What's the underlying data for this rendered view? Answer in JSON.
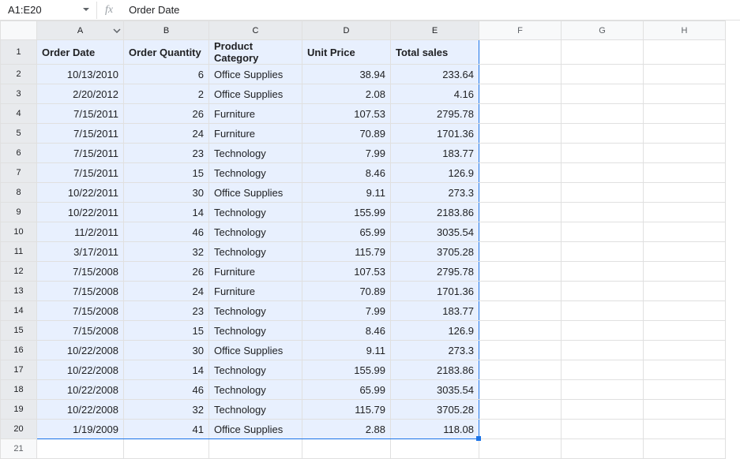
{
  "name_box": "A1:E20",
  "formula_bar": "Order Date",
  "col_headers": [
    "A",
    "B",
    "C",
    "D",
    "E",
    "F",
    "G",
    "H"
  ],
  "row_headers": [
    "1",
    "2",
    "3",
    "4",
    "5",
    "6",
    "7",
    "8",
    "9",
    "10",
    "11",
    "12",
    "13",
    "14",
    "15",
    "16",
    "17",
    "18",
    "19",
    "20",
    "21"
  ],
  "selected_cols": 5,
  "selected_rows": 20,
  "headers": [
    "Order Date",
    "Order Quantity",
    "Product Category",
    "Unit Price",
    "Total sales"
  ],
  "rows": [
    {
      "a": "10/13/2010",
      "b": "6",
      "c": "Office Supplies",
      "d": "38.94",
      "e": "233.64"
    },
    {
      "a": "2/20/2012",
      "b": "2",
      "c": "Office Supplies",
      "d": "2.08",
      "e": "4.16"
    },
    {
      "a": "7/15/2011",
      "b": "26",
      "c": "Furniture",
      "d": "107.53",
      "e": "2795.78"
    },
    {
      "a": "7/15/2011",
      "b": "24",
      "c": "Furniture",
      "d": "70.89",
      "e": "1701.36"
    },
    {
      "a": "7/15/2011",
      "b": "23",
      "c": "Technology",
      "d": "7.99",
      "e": "183.77"
    },
    {
      "a": "7/15/2011",
      "b": "15",
      "c": "Technology",
      "d": "8.46",
      "e": "126.9"
    },
    {
      "a": "10/22/2011",
      "b": "30",
      "c": "Office Supplies",
      "d": "9.11",
      "e": "273.3"
    },
    {
      "a": "10/22/2011",
      "b": "14",
      "c": "Technology",
      "d": "155.99",
      "e": "2183.86"
    },
    {
      "a": "11/2/2011",
      "b": "46",
      "c": "Technology",
      "d": "65.99",
      "e": "3035.54"
    },
    {
      "a": "3/17/2011",
      "b": "32",
      "c": "Technology",
      "d": "115.79",
      "e": "3705.28"
    },
    {
      "a": "7/15/2008",
      "b": "26",
      "c": "Furniture",
      "d": "107.53",
      "e": "2795.78"
    },
    {
      "a": "7/15/2008",
      "b": "24",
      "c": "Furniture",
      "d": "70.89",
      "e": "1701.36"
    },
    {
      "a": "7/15/2008",
      "b": "23",
      "c": "Technology",
      "d": "7.99",
      "e": "183.77"
    },
    {
      "a": "7/15/2008",
      "b": "15",
      "c": "Technology",
      "d": "8.46",
      "e": "126.9"
    },
    {
      "a": "10/22/2008",
      "b": "30",
      "c": "Office Supplies",
      "d": "9.11",
      "e": "273.3"
    },
    {
      "a": "10/22/2008",
      "b": "14",
      "c": "Technology",
      "d": "155.99",
      "e": "2183.86"
    },
    {
      "a": "10/22/2008",
      "b": "46",
      "c": "Technology",
      "d": "65.99",
      "e": "3035.54"
    },
    {
      "a": "10/22/2008",
      "b": "32",
      "c": "Technology",
      "d": "115.79",
      "e": "3705.28"
    },
    {
      "a": "1/19/2009",
      "b": "41",
      "c": "Office Supplies",
      "d": "2.88",
      "e": "118.08"
    }
  ]
}
